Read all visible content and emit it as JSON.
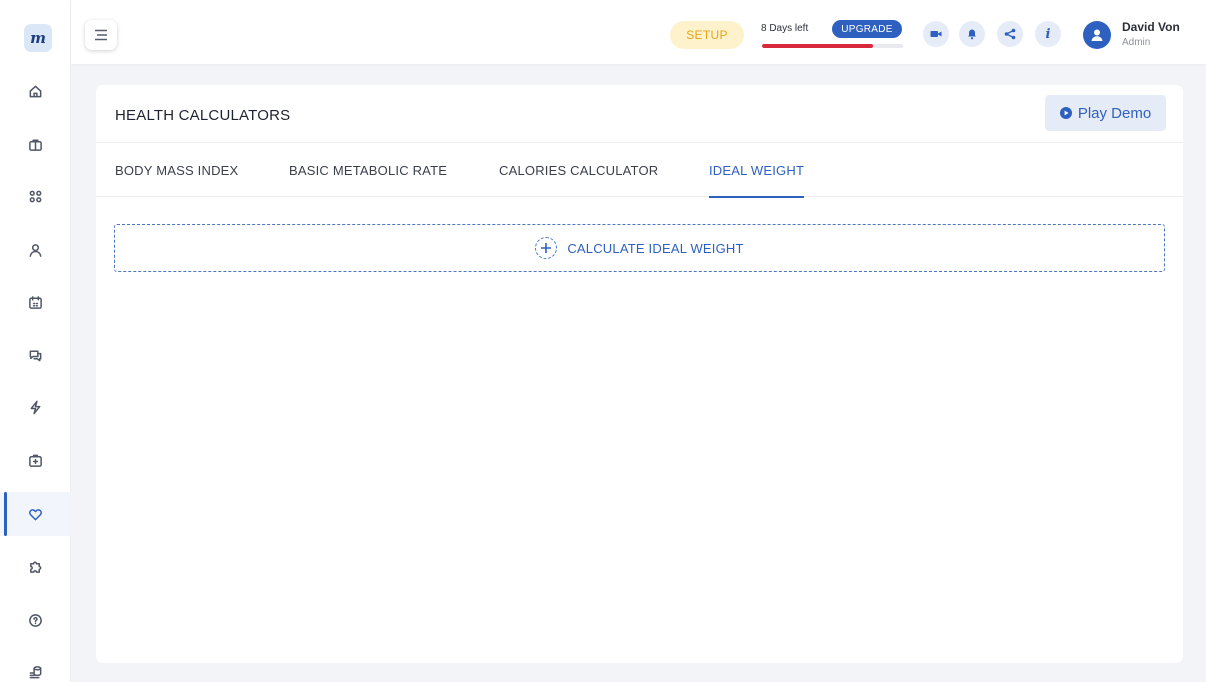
{
  "sidebar": {
    "logo_text": "m",
    "items": [
      {
        "icon": "home-icon"
      },
      {
        "icon": "briefcase-icon"
      },
      {
        "icon": "grid-icon"
      },
      {
        "icon": "user-icon"
      },
      {
        "icon": "calendar-icon"
      },
      {
        "icon": "chat-icon"
      },
      {
        "icon": "lightning-icon"
      },
      {
        "icon": "briefcase-plus-icon"
      },
      {
        "icon": "heart-icon",
        "active": true
      },
      {
        "icon": "puzzle-icon"
      },
      {
        "icon": "help-circle-icon"
      },
      {
        "icon": "database-icon"
      }
    ]
  },
  "header": {
    "setup_label": "SETUP",
    "days_left": "8 Days left",
    "upgrade_label": "UPGRADE",
    "trial_progress": 0.79,
    "icons": [
      "video-icon",
      "bell-icon",
      "share-icon",
      "info-icon"
    ],
    "info_glyph": "i",
    "user_name": "David Von",
    "user_role": "Admin"
  },
  "main": {
    "title": "HEALTH CALCULATORS",
    "demo_label": "Play Demo",
    "tabs": [
      {
        "label": "BODY MASS INDEX"
      },
      {
        "label": "BASIC METABOLIC RATE"
      },
      {
        "label": "CALORIES CALCULATOR"
      },
      {
        "label": "IDEAL WEIGHT",
        "active": true
      }
    ],
    "action_label": "CALCULATE IDEAL WEIGHT"
  },
  "colors": {
    "accent": "#2e61bf",
    "setup_bg": "#fdf2cc",
    "setup_text": "#e4a51a",
    "progress": "#d8283b",
    "background": "#f3f4f7"
  }
}
